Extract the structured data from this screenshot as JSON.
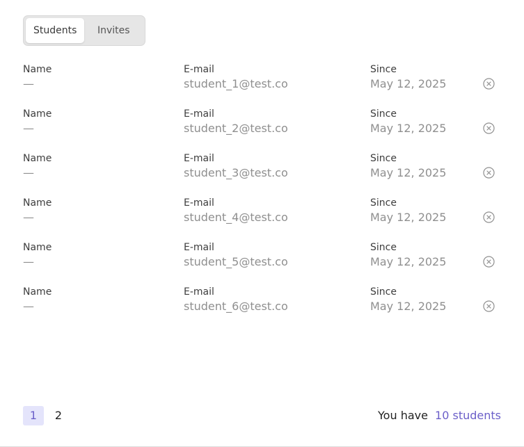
{
  "tabs": [
    {
      "label": "Students",
      "active": true
    },
    {
      "label": "Invites",
      "active": false
    }
  ],
  "columns": {
    "name": "Name",
    "email": "E-mail",
    "since": "Since"
  },
  "students": [
    {
      "name": "—",
      "email": "student_1@test.co",
      "since": "May 12, 2025"
    },
    {
      "name": "—",
      "email": "student_2@test.co",
      "since": "May 12, 2025"
    },
    {
      "name": "—",
      "email": "student_3@test.co",
      "since": "May 12, 2025"
    },
    {
      "name": "—",
      "email": "student_4@test.co",
      "since": "May 12, 2025"
    },
    {
      "name": "—",
      "email": "student_5@test.co",
      "since": "May 12, 2025"
    },
    {
      "name": "—",
      "email": "student_6@test.co",
      "since": "May 12, 2025"
    }
  ],
  "row_action_icon": "remove-circle-icon",
  "pagination": {
    "pages": [
      "1",
      "2"
    ],
    "current": "1"
  },
  "summary": {
    "prefix": "You have",
    "count_link": "10 students"
  },
  "colors": {
    "accent": "#6b5fc9",
    "accent_bg": "#e4e4fb",
    "muted_text": "#8f8f8f"
  }
}
